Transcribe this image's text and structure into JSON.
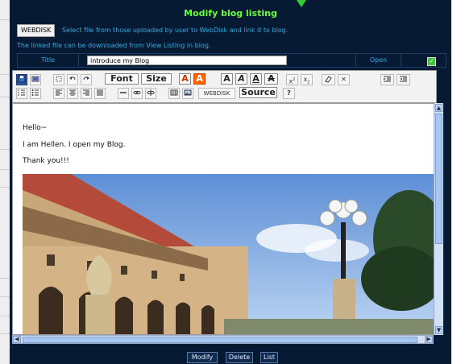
{
  "dialog": {
    "title": "Modify blog listing",
    "webdisk_button": "WEBDISK",
    "webdisk_info": "Select file from those uploaded by user to WebDisk and link it to blog.",
    "download_info": "The linked file can be downloaded from View Listing in blog."
  },
  "form": {
    "title_label": "Title",
    "title_value": "introduce my Blog",
    "open_label": "Open",
    "open_checked": true
  },
  "toolbar": {
    "font_label": "Font",
    "size_label": "Size",
    "webdisk_label": "WEBDISK",
    "source_label": "Source",
    "icons": [
      "save-icon",
      "preview-icon",
      "select-all-icon",
      "undo-icon",
      "redo-icon",
      "text-color-icon",
      "bg-color-icon",
      "bold-icon",
      "italic-icon",
      "underline-icon",
      "strikethrough-icon",
      "superscript-icon",
      "subscript-icon",
      "remove-format-icon",
      "cut-icon",
      "indent-icon",
      "outdent-icon",
      "ordered-list-icon",
      "unordered-list-icon",
      "align-left-icon",
      "align-center-icon",
      "align-right-icon",
      "justify-icon",
      "horizontal-rule-icon",
      "link-icon",
      "unlink-icon",
      "table-icon",
      "image-icon",
      "help-icon"
    ]
  },
  "editor": {
    "lines": [
      "Hello~",
      "I am Hellen. I open my Blog.",
      "Thank you!!!"
    ]
  },
  "actions": {
    "modify": "Modify",
    "delete": "Delete",
    "list": "List"
  },
  "colors": {
    "dialog_bg": "#061a33",
    "title": "#66ff33",
    "info_text": "#33aadd",
    "checkbox": "#33cc33"
  }
}
